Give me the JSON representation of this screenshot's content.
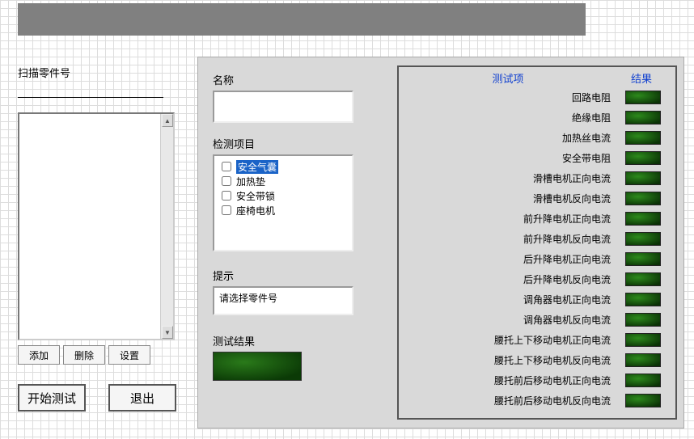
{
  "left": {
    "scan_label": "扫描零件号",
    "scan_value": "",
    "buttons": {
      "add": "添加",
      "delete": "删除",
      "settings": "设置"
    },
    "start": "开始测试",
    "exit": "退出"
  },
  "mid": {
    "name_label": "名称",
    "name_value": "",
    "checklist_label": "检测项目",
    "check_items": [
      {
        "label": "安全气囊",
        "checked": false,
        "selected": true
      },
      {
        "label": "加热垫",
        "checked": false,
        "selected": false
      },
      {
        "label": "安全带锁",
        "checked": false,
        "selected": false
      },
      {
        "label": "座椅电机",
        "checked": false,
        "selected": false
      }
    ],
    "hint_label": "提示",
    "hint_value": "请选择零件号",
    "result_label": "测试结果"
  },
  "results": {
    "header_test": "测试项",
    "header_result": "结果",
    "items": [
      "回路电阻",
      "绝缘电阻",
      "加热丝电流",
      "安全带电阻",
      "滑槽电机正向电流",
      "滑槽电机反向电流",
      "前升降电机正向电流",
      "前升降电机反向电流",
      "后升降电机正向电流",
      "后升降电机反向电流",
      "调角器电机正向电流",
      "调角器电机反向电流",
      "腰托上下移动电机正向电流",
      "腰托上下移动电机反向电流",
      "腰托前后移动电机正向电流",
      "腰托前后移动电机反向电流"
    ]
  }
}
